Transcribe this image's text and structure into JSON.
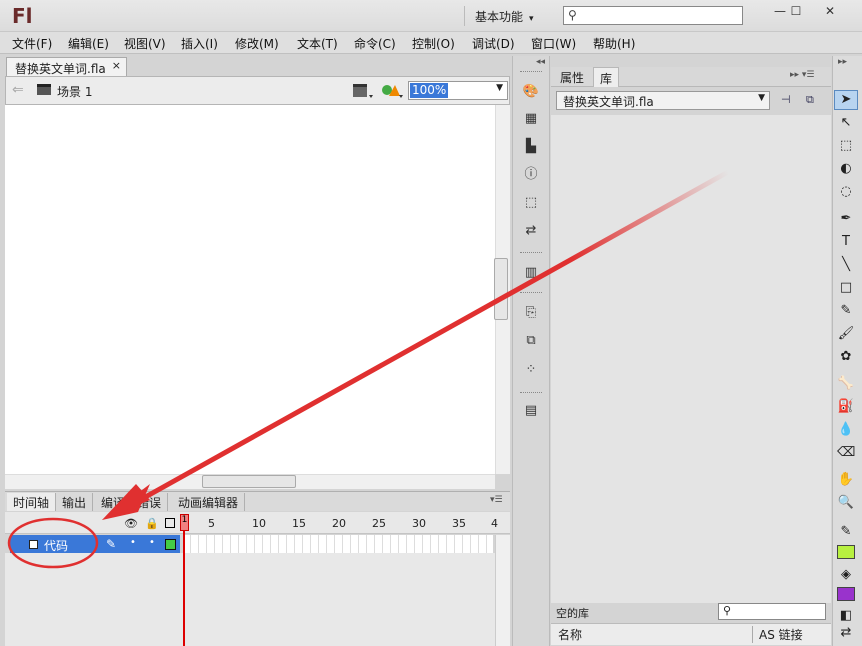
{
  "app": {
    "logo": "Fl",
    "workspace": "基本功能",
    "workspace_arrow": "▾",
    "window_buttons": [
      "—",
      "☐",
      "✕"
    ]
  },
  "menubar": [
    "文件(F)",
    "编辑(E)",
    "视图(V)",
    "插入(I)",
    "修改(M)",
    "文本(T)",
    "命令(C)",
    "控制(O)",
    "调试(D)",
    "窗口(W)",
    "帮助(H)"
  ],
  "document": {
    "tab_title": "替换英文单词.fla",
    "tab_close": "×",
    "scene_label": "场景 1",
    "zoom": "100%"
  },
  "timeline": {
    "tabs": [
      "时间轴",
      "输出",
      "编译器错误",
      "动画编辑器"
    ],
    "frame_numbers": [
      "1",
      "5",
      "10",
      "15",
      "20",
      "25",
      "30",
      "35",
      "4"
    ],
    "layer_name": "代码",
    "playhead_frame": "1"
  },
  "library": {
    "tabs": [
      "属性",
      "库"
    ],
    "document_select": "替换英文单词.fla",
    "empty_text": "空的库",
    "col_name": "名称",
    "col_linkage": "AS 链接"
  },
  "icons": {
    "search": "search-icon",
    "back": "back-arrow-icon",
    "scene": "clapper-icon"
  },
  "colors": {
    "accent": "#3a78d8",
    "stroke_swatch": "#b8f040",
    "fill_swatch": "#9933cc",
    "annotation": "#e03030"
  }
}
